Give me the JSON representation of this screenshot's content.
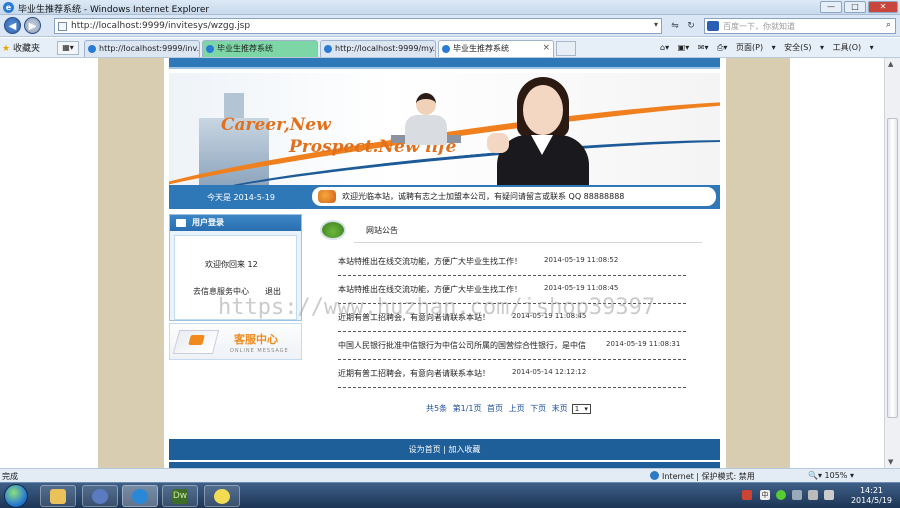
{
  "window": {
    "title": "毕业生推荐系统 - Windows Internet Explorer",
    "min": "—",
    "max": "□",
    "close": "✕"
  },
  "address": {
    "url": "http://localhost:9999/invitesys/wzgg.jsp",
    "search_placeholder": "百度一下，你就知道"
  },
  "favorites_label": "收藏夹",
  "tabs": [
    {
      "label": "http://localhost:9999/inv..."
    },
    {
      "label": "毕业生推荐系统"
    },
    {
      "label": "http://localhost:9999/my..."
    },
    {
      "label": "毕业生推荐系统"
    }
  ],
  "toolbar": {
    "items": "页面(P) ▾  安全(S) ▾  工具(O) ▾"
  },
  "site": {
    "banner_line1": "Career,New",
    "banner_line2": "Prospect.New life",
    "date": "今天是 2014-5-19",
    "marquee": "欢迎光临本站，诚聘有志之士加盟本公司，有疑问请留言或联系 QQ 88888888",
    "login": {
      "header": "用户登录",
      "welcome": "欢迎你回来 12",
      "link_info": "去信息服务中心",
      "link_logout": "退出"
    },
    "service": {
      "title": "客服中心",
      "subtitle": "ONLINE MESSAGE"
    },
    "news": {
      "title": "网站公告",
      "items": [
        {
          "title": "本站特推出在线交流功能，方便广大毕业生找工作！",
          "date": "2014-05-19 11:08:52"
        },
        {
          "title": "本站特推出在线交流功能，方便广大毕业生找工作！",
          "date": "2014-05-19 11:08:45"
        },
        {
          "title": "近期有普工招聘会，有意向者请联系本站！",
          "date": "2014-05-19 11:08:45"
        },
        {
          "title": "中国人民银行批准中信银行为中信公司所属的国营综合性银行，是中信",
          "date": "2014-05-19 11:08:31"
        },
        {
          "title": "近期有普工招聘会，有意向者请联系本站！",
          "date": "2014-05-14 12:12:12"
        }
      ]
    },
    "pager": {
      "text": "共5条 第1/1页 首页 上页 下页 末页",
      "select_value": "1"
    },
    "footer": "设为首页 | 加入收藏"
  },
  "watermark": "https://www.huzhan.com/ishop39397",
  "status": {
    "left": "完成",
    "zone": "Internet | 保护模式: 禁用",
    "zoom": "105%"
  },
  "clock": {
    "time": "14:21",
    "date": "2014/5/19"
  },
  "taskbar": {
    "dw_label": "Dw"
  }
}
